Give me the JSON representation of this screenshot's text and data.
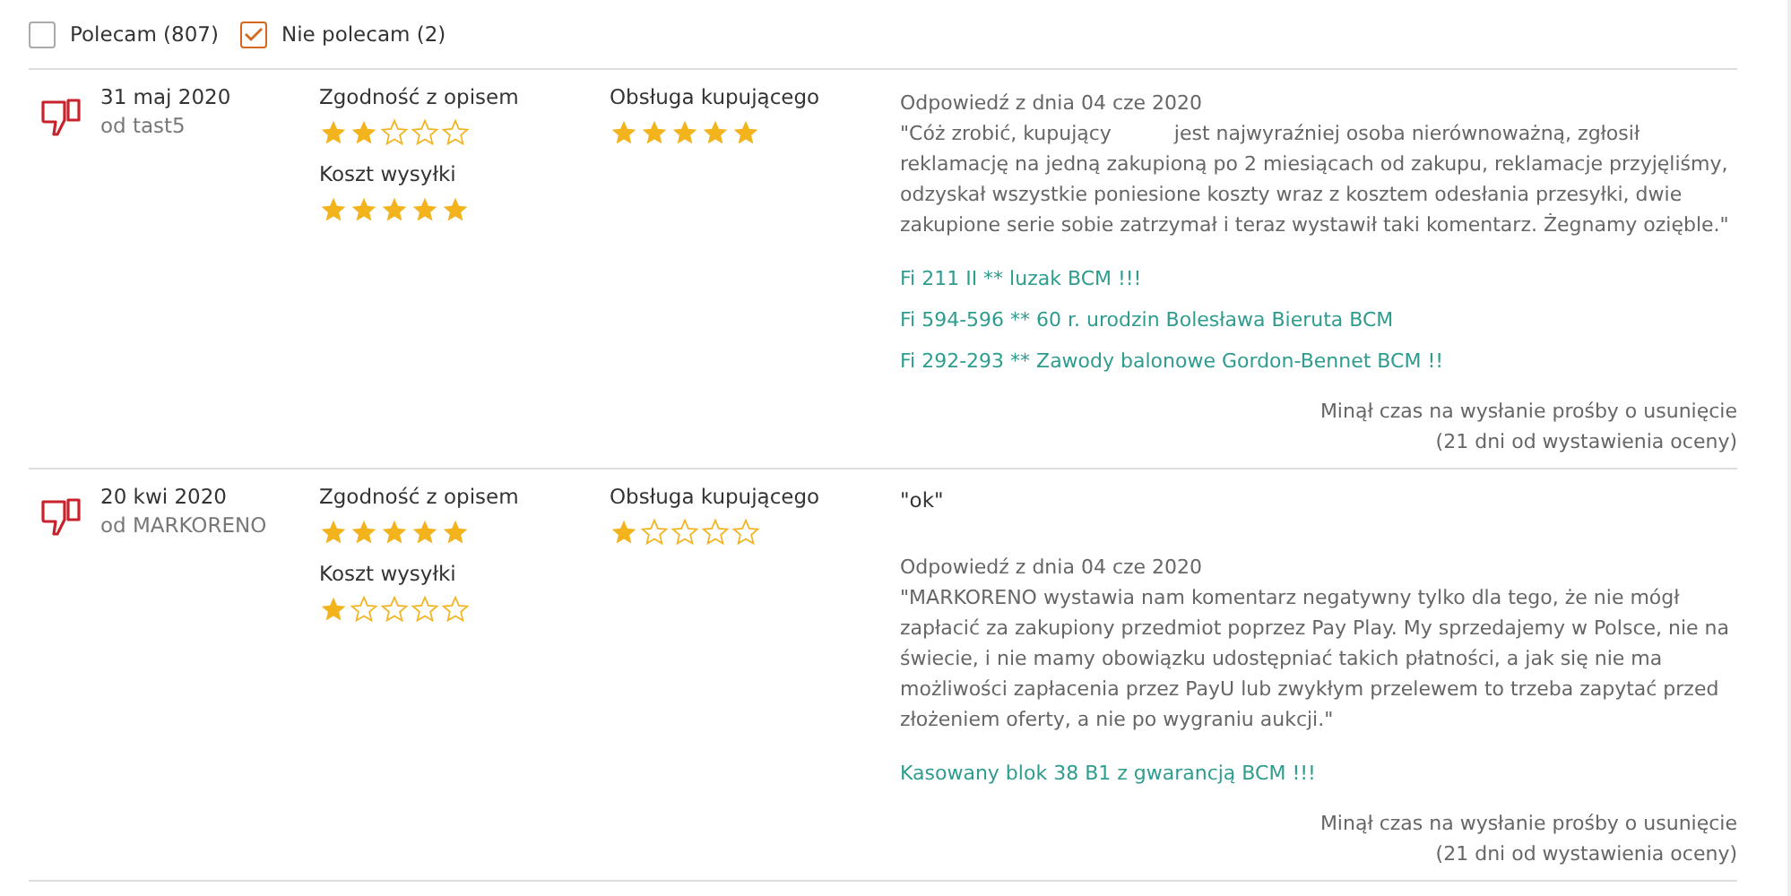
{
  "filters": [
    {
      "label": "Polecam (807)",
      "checked": false
    },
    {
      "label": "Nie polecam (2)",
      "checked": true
    }
  ],
  "reviews": [
    {
      "date": "31 maj 2020",
      "author": "od tast5",
      "rating_columns": [
        [
          {
            "label": "Zgodność z opisem",
            "stars": 2
          },
          {
            "label": "Koszt wysyłki",
            "stars": 5
          }
        ],
        [
          {
            "label": "Obsługa kupującego",
            "stars": 5
          }
        ]
      ],
      "reply": {
        "header": "Odpowiedź z dnia 04 cze 2020",
        "text": "\"Cóż zrobić, kupujący          jest najwyraźniej osoba nierównoważną, zgłosił reklamację na jedną zakupioną po 2 miesiącach od zakupu, reklamacje przyjęliśmy, odzyskał wszystkie poniesione koszty wraz z kosztem odesłania przesyłki, dwie zakupione serie sobie zatrzymał i teraz wystawił taki komentarz. Żegnamy ozięble.\""
      },
      "items": [
        "Fi 211 II ** luzak BCM !!!",
        "Fi 594-596 ** 60 r. urodzin Bolesława Bieruta BCM",
        "Fi 292-293 ** Zawody balonowe Gordon-Bennet BCM !!"
      ],
      "removal_note": [
        "Minął czas na wysłanie prośby o usunięcie",
        "(21 dni od wystawienia oceny)"
      ]
    },
    {
      "date": "20 kwi 2020",
      "author": "od MARKORENO",
      "rating_columns": [
        [
          {
            "label": "Zgodność z opisem",
            "stars": 5
          },
          {
            "label": "Koszt wysyłki",
            "stars": 1
          }
        ],
        [
          {
            "label": "Obsługa kupującego",
            "stars": 1
          }
        ]
      ],
      "comment": "\"ok\"",
      "reply": {
        "header": "Odpowiedź z dnia 04 cze 2020",
        "text": "\"MARKORENO wystawia nam komentarz negatywny tylko dla tego, że nie mógł zapłacić za zakupiony przedmiot poprzez Pay Play. My sprzedajemy w Polsce, nie na świecie, i nie mamy obowiązku udostępniać takich płatności, a jak się nie ma możliwości zapłacenia przez PayU lub zwykłym przelewem to trzeba zapytać przed złożeniem oferty, a nie po wygraniu aukcji.\""
      },
      "items": [
        "Kasowany blok 38 B1 z gwarancją BCM !!!"
      ],
      "removal_note": [
        "Minął czas na wysłanie prośby o usunięcie",
        "(21 dni od wystawienia oceny)"
      ]
    }
  ]
}
